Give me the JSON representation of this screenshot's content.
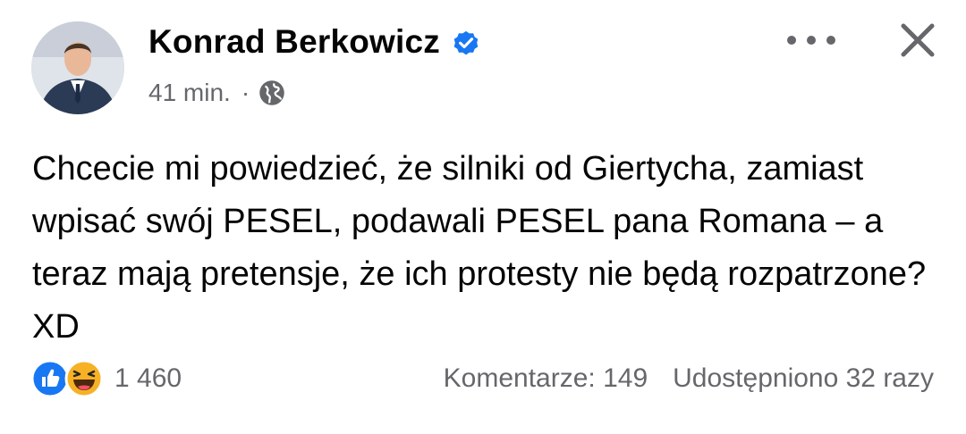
{
  "post": {
    "author": "Konrad Berkowicz",
    "time": "41 min.",
    "separator": "·",
    "text": "Chcecie mi powiedzieć, że silniki od Giertycha, zamiast wpisać swój PESEL, podawali PESEL pana Romana – a teraz mają pretensje, że ich protesty nie będą rozpatrzone? XD"
  },
  "icons": {
    "verified": "verified-badge-icon",
    "privacy": "globe-icon",
    "more": "more-horizontal-icon",
    "close": "close-icon",
    "reaction_like": "like-reaction-icon",
    "reaction_haha": "haha-reaction-icon"
  },
  "footer": {
    "reactions_count": "1 460",
    "comments": "Komentarze: 149",
    "shares": "Udostępniono 32 razy"
  },
  "colors": {
    "verified_blue": "#1877f2",
    "secondary_text": "#65676b",
    "haha_yellow": "#f7b125"
  }
}
